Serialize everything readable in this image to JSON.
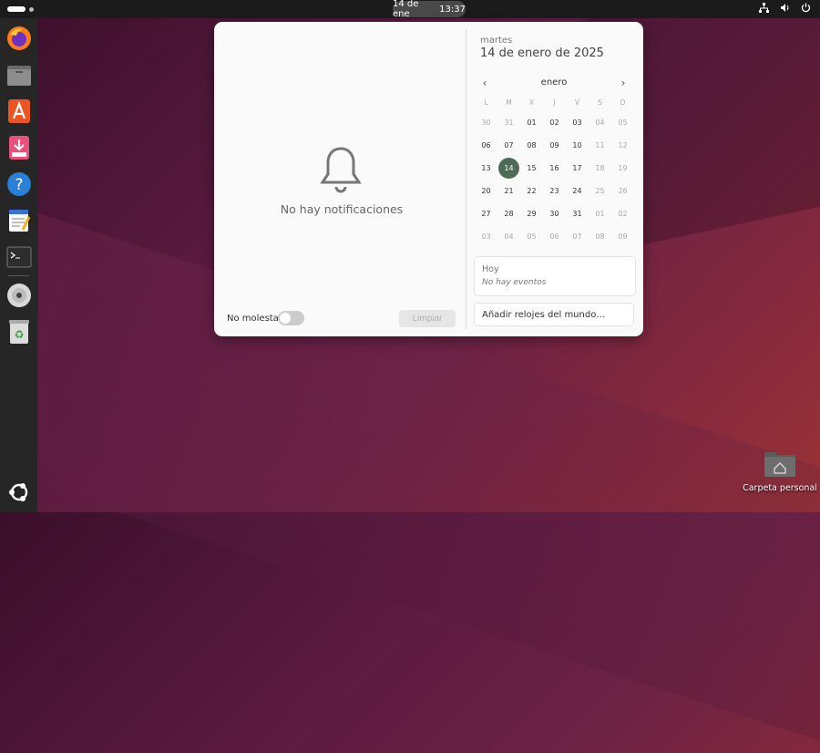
{
  "topbar": {
    "clock_date": "14 de ene",
    "clock_time": "13:37"
  },
  "dock": {
    "items": [
      "firefox-icon",
      "files-icon",
      "app-center-icon",
      "installer-icon",
      "help-icon",
      "text-editor-icon",
      "terminal-icon",
      "disc-icon",
      "trash-icon"
    ],
    "apps_grid": "ubuntu-icon"
  },
  "notifications": {
    "empty_text": "No hay notificaciones",
    "dnd_label": "No molestar",
    "dnd_enabled": false,
    "clear_label": "Limpiar"
  },
  "calendar": {
    "weekday": "martes",
    "full_date": "14 de enero de 2025",
    "month": "enero",
    "dow": [
      "L",
      "M",
      "X",
      "J",
      "V",
      "S",
      "D"
    ],
    "weeks": [
      [
        "30",
        "31",
        "01",
        "02",
        "03",
        "04",
        "05"
      ],
      [
        "06",
        "07",
        "08",
        "09",
        "10",
        "11",
        "12"
      ],
      [
        "13",
        "14",
        "15",
        "16",
        "17",
        "18",
        "19"
      ],
      [
        "20",
        "21",
        "22",
        "23",
        "24",
        "25",
        "26"
      ],
      [
        "27",
        "28",
        "29",
        "30",
        "31",
        "01",
        "02"
      ],
      [
        "03",
        "04",
        "05",
        "06",
        "07",
        "08",
        "09"
      ]
    ],
    "today": "14",
    "accent": "#4d6b57"
  },
  "events": {
    "title": "Hoy",
    "empty_text": "No hay eventos"
  },
  "world_clocks": {
    "label": "Añadir relojes del mundo…"
  },
  "desktop": {
    "home_label": "Carpeta personal"
  }
}
